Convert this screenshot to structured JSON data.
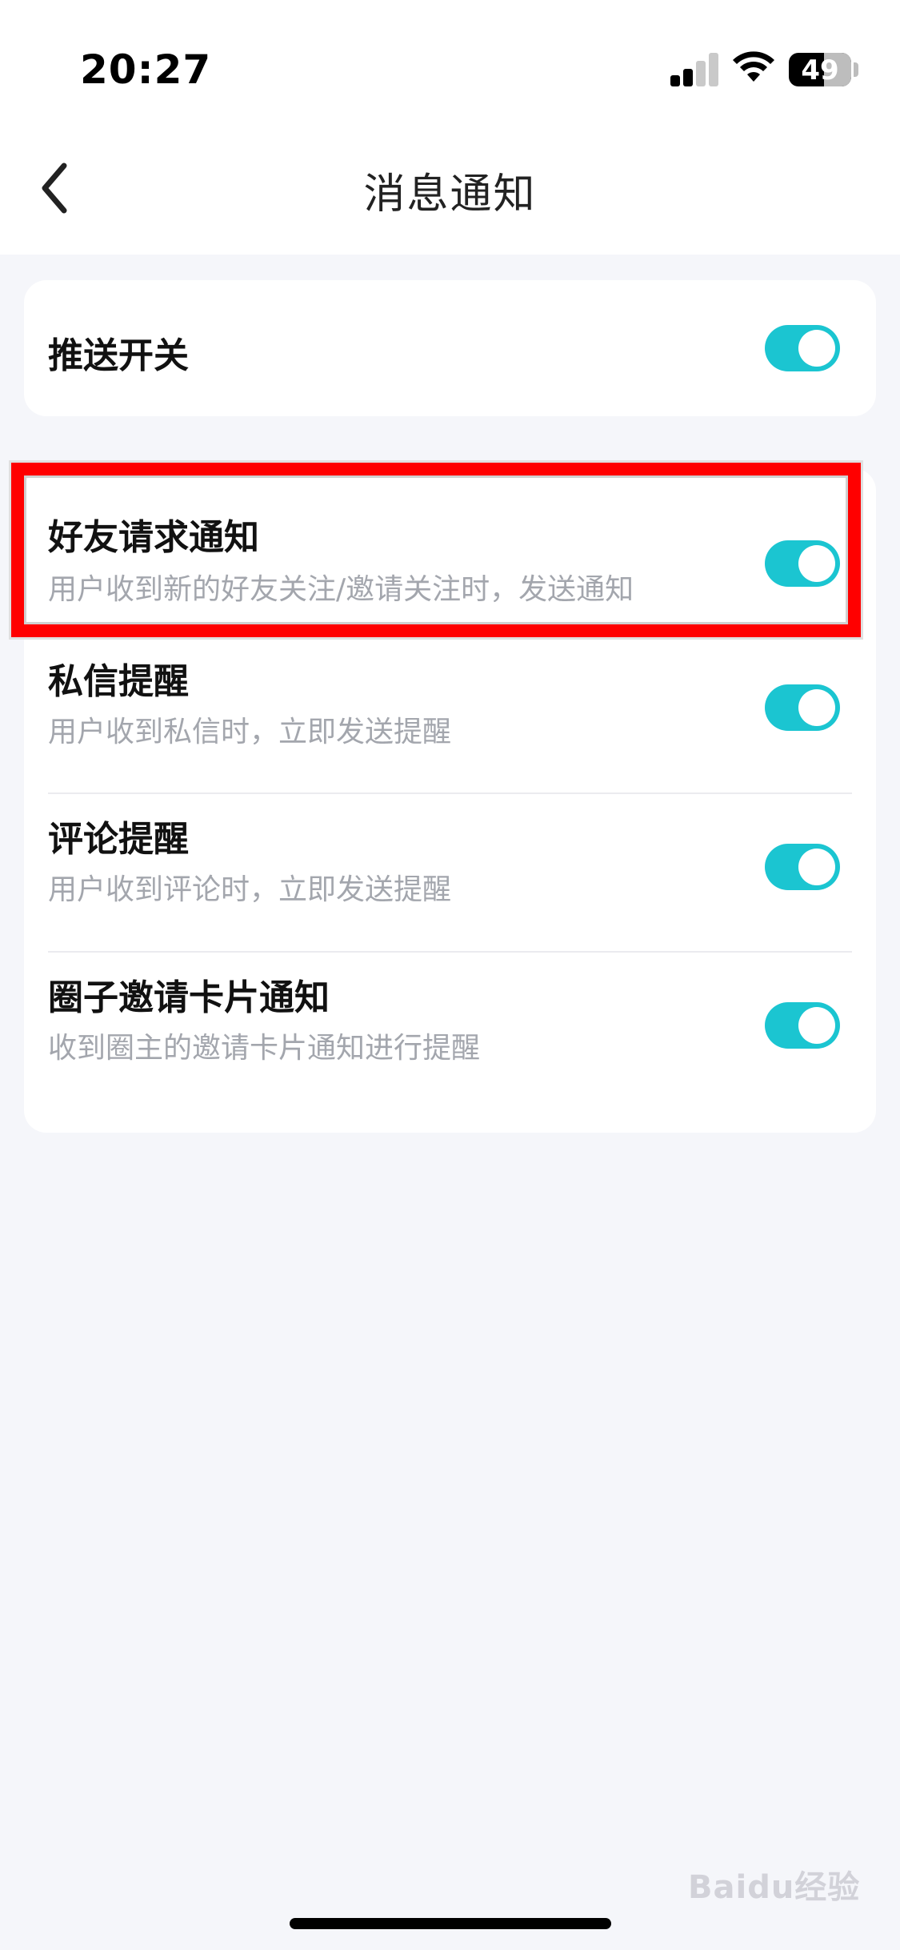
{
  "status_bar": {
    "time": "20:27",
    "battery": "49"
  },
  "nav": {
    "title": "消息通知",
    "back_icon": "chevron-left-icon"
  },
  "push_switch": {
    "label": "推送开关",
    "enabled": true
  },
  "notifications": [
    {
      "title": "好友请求通知",
      "subtitle": "用户收到新的好友关注/邀请关注时，发送通知",
      "enabled": true
    },
    {
      "title": "私信提醒",
      "subtitle": "用户收到私信时，立即发送提醒",
      "enabled": true
    },
    {
      "title": "评论提醒",
      "subtitle": "用户收到评论时，立即发送提醒",
      "enabled": true
    },
    {
      "title": "圈子邀请卡片通知",
      "subtitle": "收到圈主的邀请卡片通知进行提醒",
      "enabled": true
    }
  ],
  "watermark": "Baidu经验",
  "colors": {
    "toggle_on": "#1bc5d1",
    "highlight": "#ff0000",
    "subtitle": "#a3a6ad",
    "background": "#f5f6fa"
  }
}
